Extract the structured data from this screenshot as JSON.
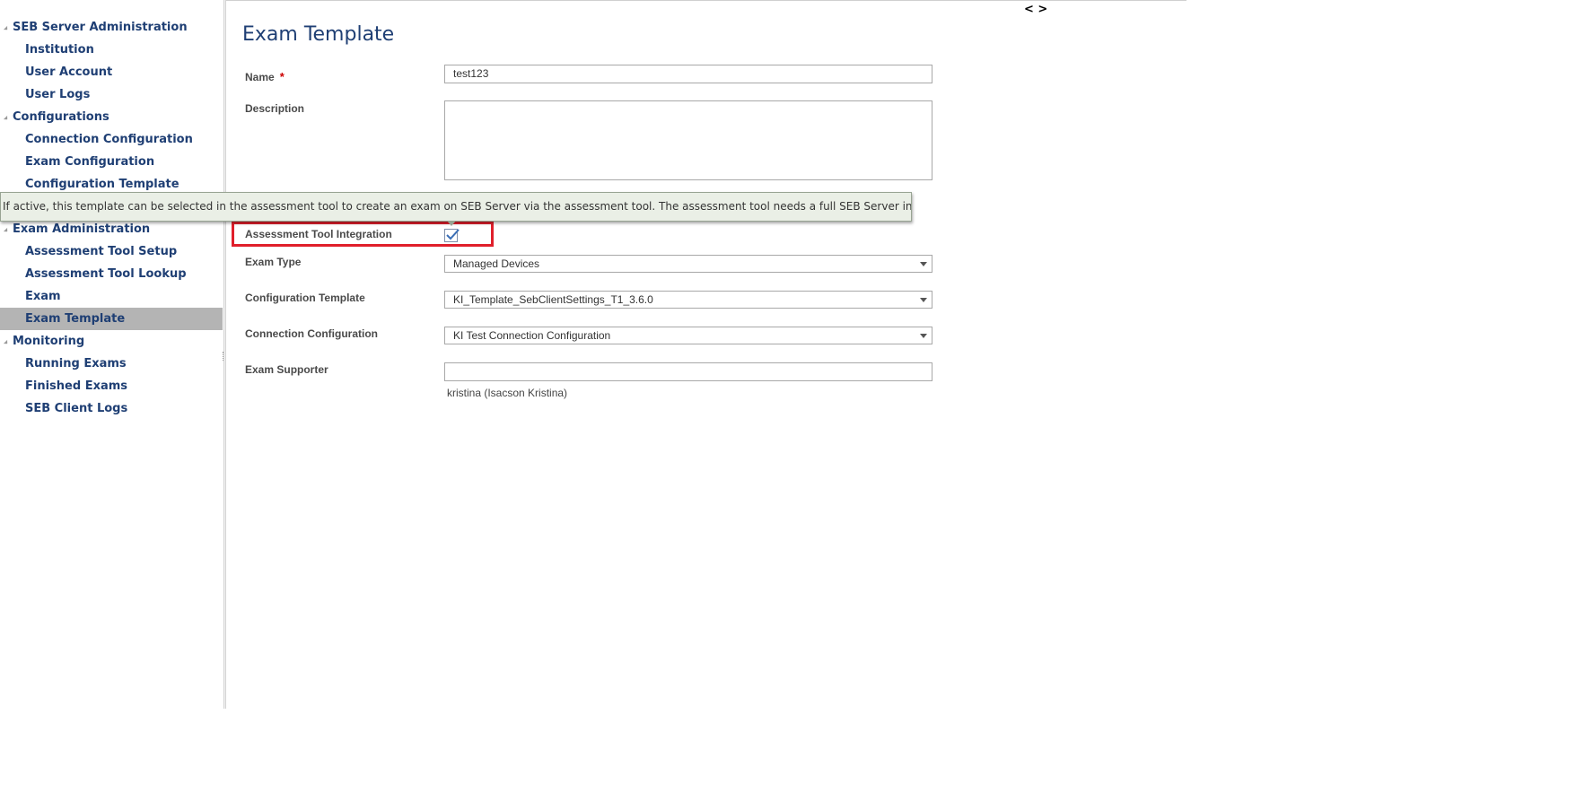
{
  "sidebar": {
    "items": [
      {
        "label": "SEB Server Administration",
        "level": "group"
      },
      {
        "label": "Institution",
        "level": "child"
      },
      {
        "label": "User Account",
        "level": "child"
      },
      {
        "label": "User Logs",
        "level": "child"
      },
      {
        "label": "Configurations",
        "level": "group"
      },
      {
        "label": "Connection Configuration",
        "level": "child"
      },
      {
        "label": "Exam Configuration",
        "level": "child"
      },
      {
        "label": "Configuration Template",
        "level": "child"
      },
      {
        "label": "Exam Administration",
        "level": "group"
      },
      {
        "label": "Assessment Tool Setup",
        "level": "child"
      },
      {
        "label": "Assessment Tool Lookup",
        "level": "child"
      },
      {
        "label": "Exam",
        "level": "child"
      },
      {
        "label": "Exam Template",
        "level": "child",
        "selected": true
      },
      {
        "label": "Monitoring",
        "level": "group"
      },
      {
        "label": "Running Exams",
        "level": "child"
      },
      {
        "label": "Finished Exams",
        "level": "child"
      },
      {
        "label": "SEB Client Logs",
        "level": "child"
      }
    ]
  },
  "header": {
    "toggle_icon": "< >",
    "title": "Exam Template"
  },
  "form": {
    "name": {
      "label": "Name",
      "required_mark": "*",
      "value": "test123"
    },
    "description": {
      "label": "Description",
      "value": ""
    },
    "assessment_tool_integration": {
      "label": "Assessment Tool Integration",
      "checked": true
    },
    "exam_type": {
      "label": "Exam Type",
      "value": "Managed Devices"
    },
    "configuration_template": {
      "label": "Configuration Template",
      "value": "KI_Template_SebClientSettings_T1_3.6.0"
    },
    "connection_configuration": {
      "label": "Connection Configuration",
      "value": "KI Test Connection Configuration"
    },
    "exam_supporter": {
      "label": "Exam Supporter",
      "value": "",
      "selected_items": [
        "kristina (Isacson Kristina)"
      ]
    }
  },
  "tooltip": {
    "text": "If active, this template can be selected in the assessment tool to create an exam on SEB Server via the assessment tool. The assessment tool needs a full SEB Server integration."
  },
  "colors": {
    "nav_text": "#1f3f74",
    "selected_bg": "#b4b4b4",
    "highlight": "#e01f2b",
    "tooltip_bg": "#eaefe6"
  }
}
